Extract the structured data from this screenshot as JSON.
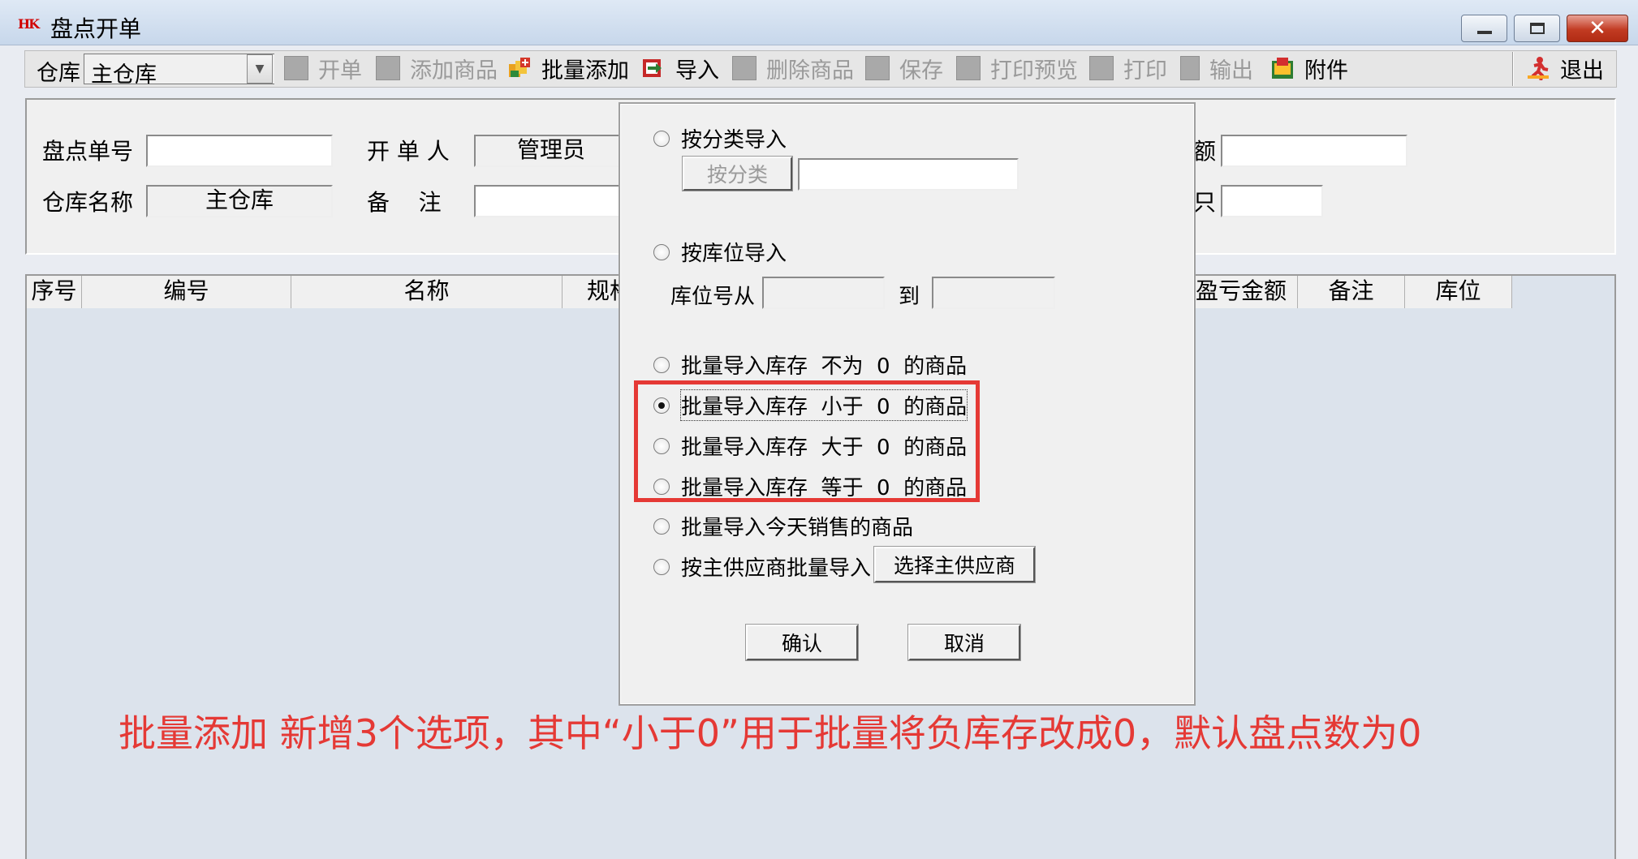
{
  "window": {
    "logo": "HK",
    "title": "盘点开单"
  },
  "toolbar": {
    "warehouse_label": "仓库",
    "warehouse_value": "主仓库",
    "items": [
      {
        "label": "开单",
        "enabled": false
      },
      {
        "label": "添加商品",
        "enabled": false
      },
      {
        "label": "批量添加",
        "enabled": true,
        "icon": "batch-add-icon"
      },
      {
        "label": "导入",
        "enabled": true,
        "icon": "import-icon"
      },
      {
        "label": "删除商品",
        "enabled": false
      },
      {
        "label": "保存",
        "enabled": false
      },
      {
        "label": "打印预览",
        "enabled": false
      },
      {
        "label": "打印",
        "enabled": false
      },
      {
        "label": "输出",
        "enabled": false
      },
      {
        "label": "附件",
        "enabled": true,
        "icon": "attachment-icon"
      }
    ],
    "exit_label": "退出"
  },
  "form": {
    "order_no_label": "盘点单号",
    "order_no_value": "",
    "creator_label": "开 单 人",
    "creator_value": "管理员",
    "warehouse_name_label": "仓库名称",
    "warehouse_name_value": "主仓库",
    "remark_label": "备    注",
    "remark_value": "",
    "amount_label_fragment": "额",
    "extra_label_fragment": "只"
  },
  "grid": {
    "columns": [
      "序号",
      "编号",
      "名称",
      "规格",
      "盈亏金额",
      "备注",
      "库位"
    ]
  },
  "dialog": {
    "by_category_label": "按分类导入",
    "by_category_button": "按分类",
    "category_value": "",
    "by_location_label": "按库位导入",
    "location_from_label": "库位号从",
    "location_to_label": "到",
    "location_from_value": "",
    "location_to_value": "",
    "stock_options": [
      {
        "label": "批量导入库存  不为  0  的商品",
        "checked": false
      },
      {
        "label": "批量导入库存  小于  0  的商品",
        "checked": true
      },
      {
        "label": "批量导入库存  大于  0  的商品",
        "checked": false
      },
      {
        "label": "批量导入库存  等于  0  的商品",
        "checked": false
      }
    ],
    "today_sales_label": "批量导入今天销售的商品",
    "by_supplier_label": "按主供应商批量导入",
    "select_supplier_button": "选择主供应商",
    "confirm_button": "确认",
    "cancel_button": "取消"
  },
  "annotation": "批量添加 新增3个选项，其中“小于0”用于批量将负库存改成0，默认盘点数为0",
  "colors": {
    "annotation": "#e53935",
    "highlight": "#e53935"
  }
}
